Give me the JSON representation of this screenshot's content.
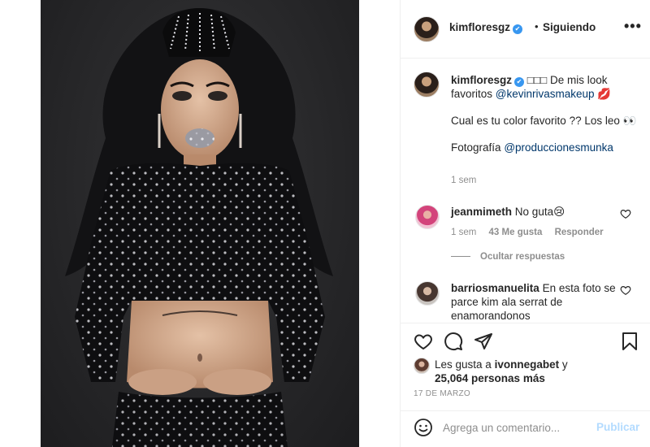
{
  "header": {
    "username": "kimfloresgz",
    "verified_mark": "✔",
    "separator": "•",
    "follow_status": "Siguiendo",
    "more_label": "•••"
  },
  "caption": {
    "username": "kimfloresgz",
    "verified_mark": "✔",
    "boxes": "□□□",
    "line1_text": "De mis look favoritos",
    "mention1": "@kevinrivasmakeup",
    "emoji1": "💋",
    "para2": "Cual es tu color favorito ?? Los leo 👀",
    "para3_text": "Fotografía",
    "mention2": "@produccionesmunka",
    "time": "1 sem"
  },
  "comments": [
    {
      "username": "jeanmimeth",
      "text": "No guta😢",
      "time": "1 sem",
      "likes": "43 Me gusta",
      "reply": "Responder",
      "hide_replies": "Ocultar respuestas"
    },
    {
      "username": "barriosmanuelita",
      "text": "En esta foto se parce kim ala serrat de enamorandonos"
    }
  ],
  "actions": {
    "icons": [
      "heart-icon",
      "comment-icon",
      "share-icon",
      "bookmark-icon"
    ],
    "liked_by_prefix": "Les gusta a",
    "liked_by_user": "ivonnegabet",
    "liked_by_suffix": "y",
    "likes_count": "25,064 personas más",
    "date": "17 DE MARZO"
  },
  "add_comment": {
    "placeholder": "Agrega un comentario...",
    "publish": "Publicar"
  },
  "colors": {
    "link": "#00376b",
    "verified": "#3897f0",
    "publish_disabled": "#b3dbff",
    "muted": "#8e8e8e"
  }
}
